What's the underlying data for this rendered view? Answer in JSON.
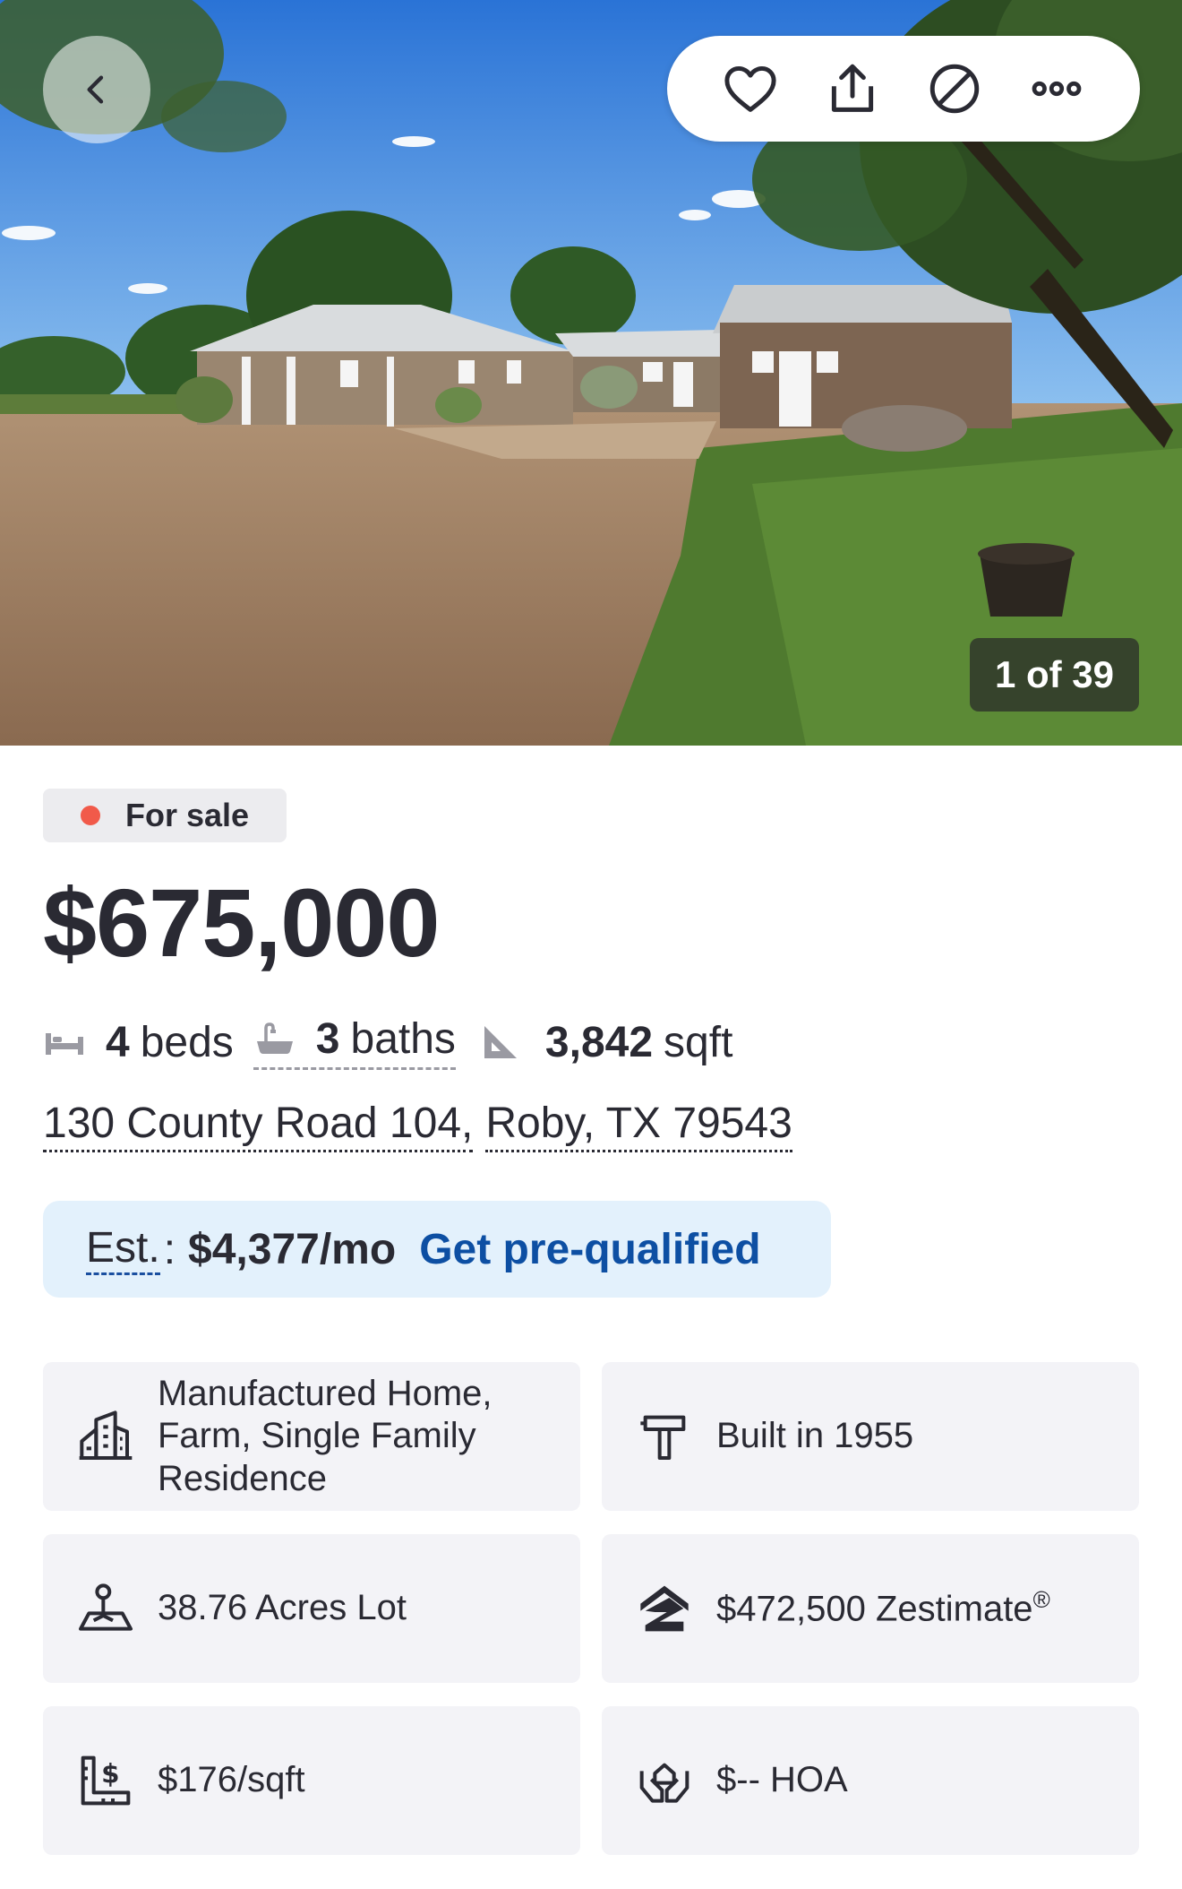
{
  "hero": {
    "photo_counter": "1 of 39"
  },
  "icons": {
    "back": "chevron-left-icon",
    "save": "heart-icon",
    "share": "share-icon",
    "hide": "hide-icon",
    "more": "more-icon"
  },
  "listing": {
    "status": "For sale",
    "status_color": "#f15a4a",
    "price": "$675,000",
    "beds_num": "4",
    "beds_label": "beds",
    "baths_num": "3",
    "baths_label": "baths",
    "sqft_num": "3,842",
    "sqft_label": "sqft",
    "address_street": "130 County Road 104,",
    "address_city": "Roby, TX 79543"
  },
  "payment": {
    "est_label": "Est.",
    "est_sep": ":",
    "est_value": "$4,377/mo",
    "cta": "Get pre-qualified",
    "cta_color": "#0d4fa3"
  },
  "details": {
    "type": "Manufactured Home, Farm, Single Family Residence",
    "built": "Built in 1955",
    "lot": "38.76 Acres Lot",
    "zestimate": "$472,500 Zestimate",
    "zestimate_mark": "®",
    "price_per_sqft": "$176/sqft",
    "hoa": "$-- HOA"
  }
}
